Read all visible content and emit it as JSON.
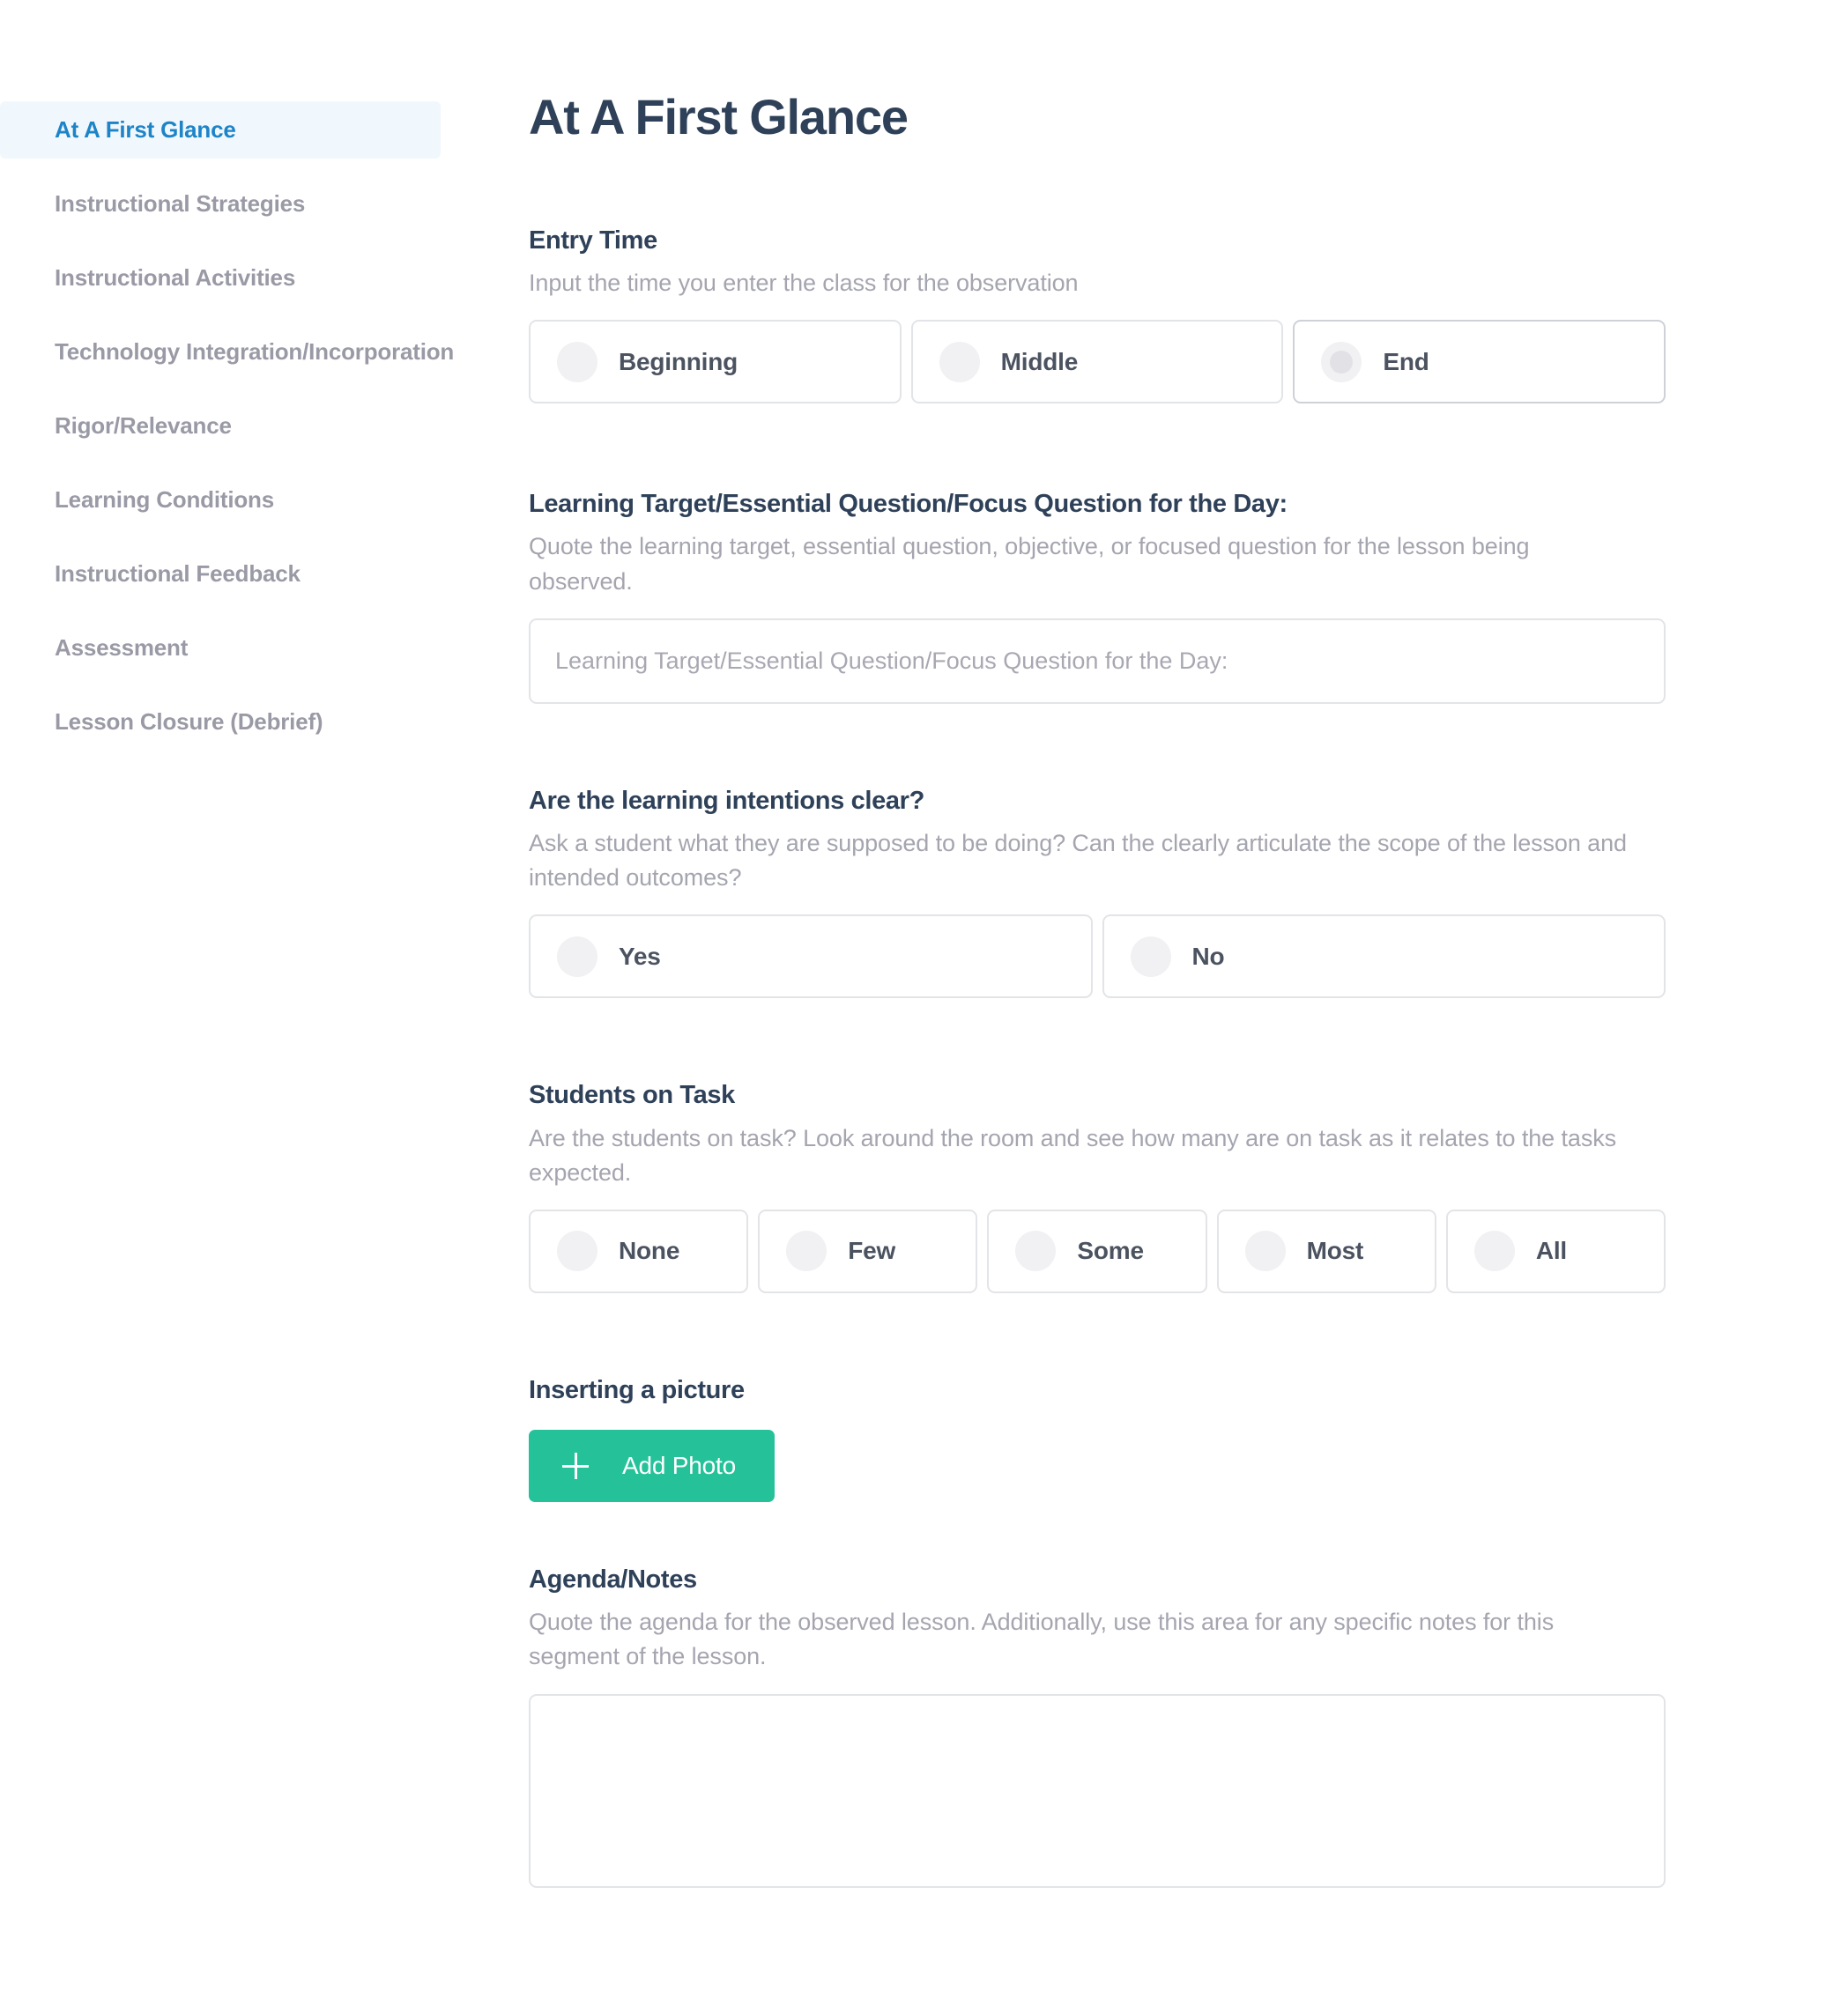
{
  "sidebar": {
    "items": [
      {
        "label": "At A First Glance",
        "active": true
      },
      {
        "label": "Instructional Strategies",
        "active": false
      },
      {
        "label": "Instructional Activities",
        "active": false
      },
      {
        "label": "Technology Integration/Incorporation",
        "active": false
      },
      {
        "label": "Rigor/Relevance",
        "active": false
      },
      {
        "label": "Learning Conditions",
        "active": false
      },
      {
        "label": "Instructional Feedback",
        "active": false
      },
      {
        "label": "Assessment",
        "active": false
      },
      {
        "label": "Lesson Closure (Debrief)",
        "active": false
      }
    ]
  },
  "main": {
    "title": "At A First Glance",
    "entry_time": {
      "title": "Entry Time",
      "help": "Input the time you enter the class for the observation",
      "options": [
        {
          "label": "Beginning",
          "hovered": false
        },
        {
          "label": "Middle",
          "hovered": false
        },
        {
          "label": "End",
          "hovered": true
        }
      ]
    },
    "learning_target": {
      "title": "Learning Target/Essential Question/Focus Question for the Day:",
      "help": "Quote the learning target, essential question, objective, or focused question for the lesson being observed.",
      "placeholder": "Learning Target/Essential Question/Focus Question for the Day:",
      "value": ""
    },
    "intentions_clear": {
      "title": "Are the learning intentions clear?",
      "help": "Ask a student what they are supposed to be doing? Can the clearly articulate the scope of the lesson and intended outcomes?",
      "options": [
        {
          "label": "Yes",
          "hovered": false
        },
        {
          "label": "No",
          "hovered": false
        }
      ]
    },
    "students_on_task": {
      "title": "Students on Task",
      "help": "Are the students on task? Look around the room and see how many are on task as it relates to the tasks expected.",
      "options": [
        {
          "label": "None",
          "hovered": false
        },
        {
          "label": "Few",
          "hovered": false
        },
        {
          "label": "Some",
          "hovered": false
        },
        {
          "label": "Most",
          "hovered": false
        },
        {
          "label": "All",
          "hovered": false
        }
      ]
    },
    "inserting_picture": {
      "title": "Inserting a picture",
      "add_photo_label": "Add Photo",
      "plus_icon": "plus-icon"
    },
    "agenda_notes": {
      "title": "Agenda/Notes",
      "help": "Quote the agenda for the observed lesson. Additionally, use this area for any specific notes for this segment of the lesson.",
      "placeholder": "",
      "value": ""
    }
  },
  "colors": {
    "accent_blue": "#1d84c8",
    "active_bg": "#f1f8fd",
    "heading": "#2e4159",
    "muted": "#a5a5b0",
    "nav_muted": "#9a9aa6",
    "border": "#e3e4e8",
    "green": "#25c29a",
    "radio": "#f1f1f3"
  }
}
